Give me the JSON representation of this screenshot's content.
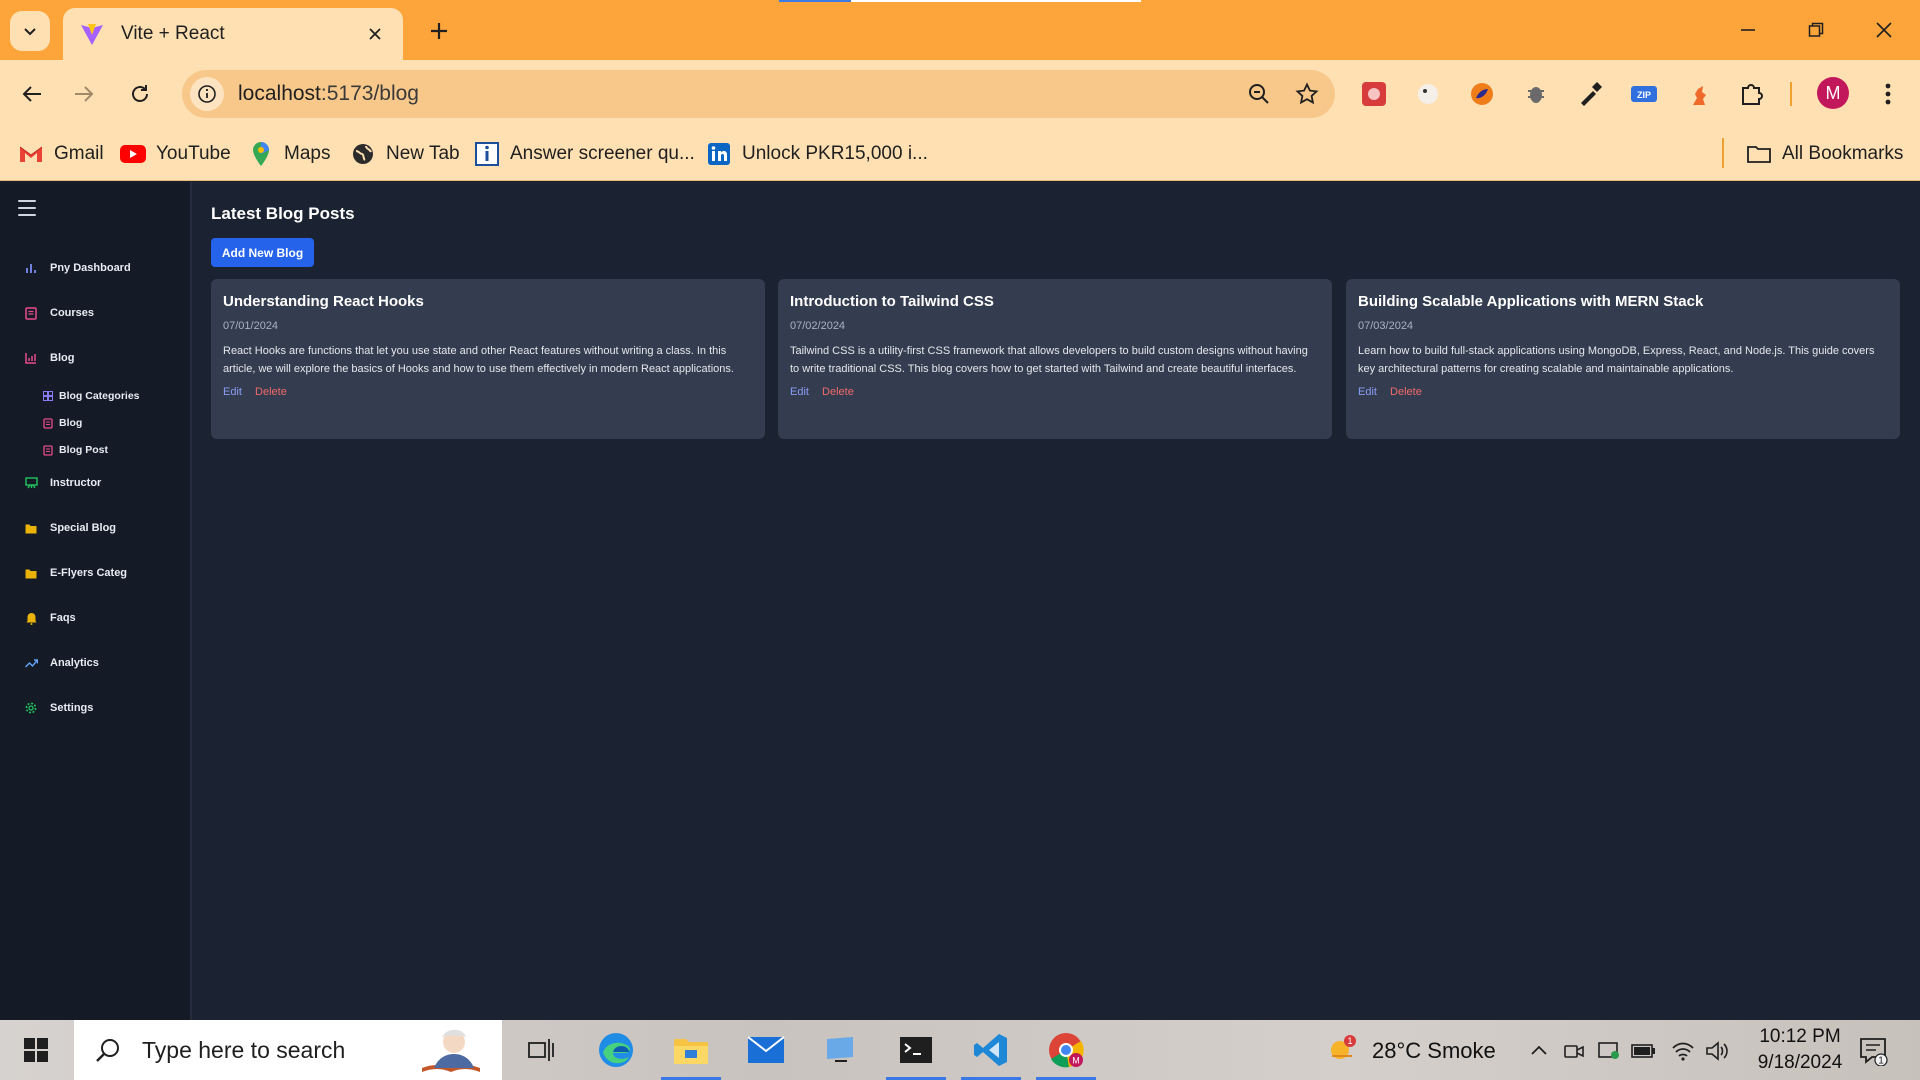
{
  "browser": {
    "tab_title": "Vite + React",
    "url_host": "localhost",
    "url_path": ":5173/blog",
    "profile_initial": "M",
    "bookmarks": [
      {
        "label": "Gmail",
        "icon": "gmail-icon"
      },
      {
        "label": "YouTube",
        "icon": "youtube-icon"
      },
      {
        "label": "Maps",
        "icon": "maps-icon"
      },
      {
        "label": "New Tab",
        "icon": "globe-icon"
      },
      {
        "label": "Answer screener qu...",
        "icon": "info-bookmark-icon"
      },
      {
        "label": "Unlock PKR15,000 i...",
        "icon": "linkedin-icon"
      }
    ],
    "all_bookmarks": "All Bookmarks"
  },
  "sidebar": {
    "items": [
      {
        "label": "Pny Dashboard",
        "icon": "bar-chart-icon",
        "color": "#7c8cf8"
      },
      {
        "label": "Courses",
        "icon": "book-icon",
        "color": "#e84a8a"
      },
      {
        "label": "Blog",
        "icon": "chart-icon",
        "color": "#e84a8a"
      },
      {
        "label": "Instructor",
        "icon": "instructor-icon",
        "color": "#22c55e"
      },
      {
        "label": "Special Blog",
        "icon": "folder-icon",
        "color": "#eab308"
      },
      {
        "label": "E-Flyers Categ",
        "icon": "folder-icon",
        "color": "#eab308"
      },
      {
        "label": "Faqs",
        "icon": "bell-icon",
        "color": "#eab308"
      },
      {
        "label": "Analytics",
        "icon": "trend-icon",
        "color": "#60a5fa"
      },
      {
        "label": "Settings",
        "icon": "gear-icon",
        "color": "#22c55e"
      }
    ],
    "sub_items": [
      {
        "label": "Blog Categories",
        "icon": "grid-icon",
        "color": "#8b7cf6"
      },
      {
        "label": "Blog",
        "icon": "book-icon",
        "color": "#e84a8a"
      },
      {
        "label": "Blog Post",
        "icon": "book-icon",
        "color": "#e84a8a"
      }
    ]
  },
  "main": {
    "title": "Latest Blog Posts",
    "add_button": "Add New Blog",
    "edit_label": "Edit",
    "delete_label": "Delete",
    "posts": [
      {
        "title": "Understanding React Hooks",
        "date": "07/01/2024",
        "body": "React Hooks are functions that let you use state and other React features without writing a class. In this article, we will explore the basics of Hooks and how to use them effectively in modern React applications."
      },
      {
        "title": "Introduction to Tailwind CSS",
        "date": "07/02/2024",
        "body": "Tailwind CSS is a utility-first CSS framework that allows developers to build custom designs without having to write traditional CSS. This blog covers how to get started with Tailwind and create beautiful interfaces."
      },
      {
        "title": "Building Scalable Applications with MERN Stack",
        "date": "07/03/2024",
        "body": "Learn how to build full-stack applications using MongoDB, Express, React, and Node.js. This guide covers key architectural patterns for creating scalable and maintainable applications."
      }
    ]
  },
  "taskbar": {
    "search_placeholder": "Type here to search",
    "weather": "28°C  Smoke",
    "weather_badge": "1",
    "time": "10:12 PM",
    "date": "9/18/2024",
    "notification_count": "1"
  },
  "colors": {
    "accent": "#2563eb",
    "tabstrip": "#fda53a",
    "toolbar": "#ffe0b2",
    "app_bg": "#1b2231",
    "card_bg": "#343d4f"
  }
}
